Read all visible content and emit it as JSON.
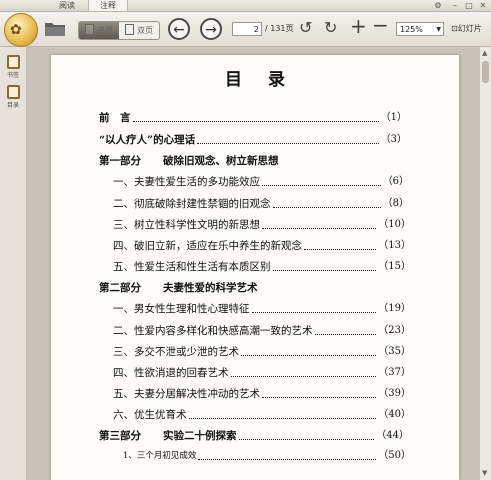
{
  "tabs": {
    "read": "阅读",
    "annotate": "注释"
  },
  "window": {
    "settings": "⚙",
    "minimize": "–",
    "maximize": "□",
    "close": "✕"
  },
  "toolbar": {
    "single_page": "单页",
    "double_page": "双页",
    "page_current": "2",
    "page_total": "/ 131页",
    "zoom": "125%",
    "slideshow": "幻灯片"
  },
  "sidebar": {
    "bookmark": "书签",
    "toc": "目录"
  },
  "document": {
    "title": "目录",
    "entries": [
      {
        "text": "前　言",
        "page": "（1）"
      },
      {
        "text": "“以人疗人”的心理话",
        "page": "（3）"
      },
      {
        "text_a": "第一部分",
        "text_b": "破除旧观念、树立新思想"
      },
      {
        "text": "一、夫妻性爱生活的多功能效应",
        "page": "（6）"
      },
      {
        "text": "二、彻底破除封建性禁锢的旧观念",
        "page": "（8）"
      },
      {
        "text": "三、树立性科学性文明的新思想",
        "page": "（10）"
      },
      {
        "text": "四、破旧立新，适应在乐中养生的新观念",
        "page": "（13）"
      },
      {
        "text": "五、性爱生活和性生活有本质区别",
        "page": "（15）"
      },
      {
        "text_a": "第二部分",
        "text_b": "夫妻性爱的科学艺术"
      },
      {
        "text": "一、男女性生理和性心理特征",
        "page": "（19）"
      },
      {
        "text": "二、性爱内容多样化和快感高潮一致的艺术",
        "page": "（23）"
      },
      {
        "text": "三、多交不泄或少泄的艺术",
        "page": "（35）"
      },
      {
        "text": "四、性欲消退的回春艺术",
        "page": "（37）"
      },
      {
        "text": "五、夫妻分居解决性冲动的艺术",
        "page": "（39）"
      },
      {
        "text": "六、优生优育术",
        "page": "（40）"
      },
      {
        "text_a": "第三部分",
        "text_b": "实验二十例探索",
        "page": "（44）"
      },
      {
        "text": "1、三个月初见成效",
        "page": "（50）"
      }
    ]
  }
}
